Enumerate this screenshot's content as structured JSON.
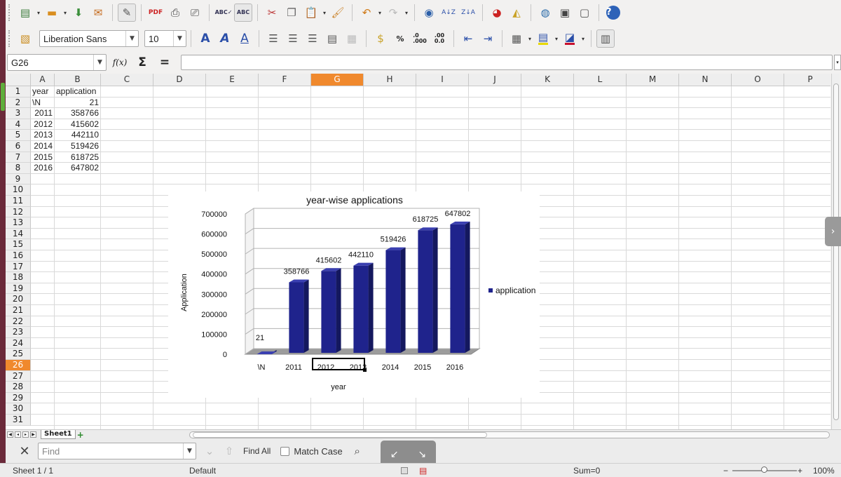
{
  "toolbar_standard": {
    "icons": [
      "new-icon",
      "open-icon",
      "save-icon",
      "export-icon",
      "edit-file-icon",
      "export-pdf-icon",
      "print-icon",
      "print-preview-icon",
      "spellcheck-icon",
      "autospellcheck-icon",
      "cut-icon",
      "copy-icon",
      "paste-icon",
      "clone-format-icon",
      "undo-icon",
      "redo-icon",
      "navigator-icon",
      "sort-ascending-icon",
      "sort-descending-icon",
      "insert-chart-icon",
      "draw-functions-icon",
      "gallery-icon",
      "data-sources-icon",
      "help-icon"
    ]
  },
  "toolbar_format": {
    "font_name": "Liberation Sans",
    "font_size": "10",
    "number_buttons": {
      "percent": "%",
      "add_decimal": ".0\n.000",
      "del_decimal": ".00\n0.0"
    }
  },
  "formula_bar": {
    "name_box": "G26",
    "function_wizard": "f(x)",
    "sum": "Σ",
    "equals": "=",
    "content": ""
  },
  "grid": {
    "columns": [
      "A",
      "B",
      "C",
      "D",
      "E",
      "F",
      "G",
      "H",
      "I",
      "J",
      "K",
      "L",
      "M",
      "N",
      "O",
      "P"
    ],
    "selected_column": "G",
    "rows": [
      "1",
      "2",
      "3",
      "4",
      "5",
      "6",
      "7",
      "8",
      "9",
      "10",
      "11",
      "12",
      "13",
      "14",
      "15",
      "16",
      "17",
      "18",
      "19",
      "20",
      "21",
      "22",
      "23",
      "24",
      "25",
      "26",
      "27",
      "28",
      "29",
      "30",
      "31"
    ],
    "selected_row": "26",
    "cells": {
      "A1": "year",
      "B1": "application",
      "A2": "\\N",
      "B2": "21",
      "A3": "2011",
      "B3": "358766",
      "A4": "2012",
      "B4": "415602",
      "A5": "2013",
      "B5": "442110",
      "A6": "2014",
      "B6": "519426",
      "A7": "2015",
      "B7": "618725",
      "A8": "2016",
      "B8": "647802"
    }
  },
  "chart_data": {
    "type": "bar",
    "title": "year-wise applications",
    "xlabel": "year",
    "ylabel": "Application",
    "categories": [
      "\\N",
      "2011",
      "2012",
      "2013",
      "2014",
      "2015",
      "2016"
    ],
    "series": [
      {
        "name": "application",
        "values": [
          21,
          358766,
          415602,
          442110,
          519426,
          618725,
          647802
        ],
        "color": "#1f238c"
      }
    ],
    "ylim": [
      0,
      700000
    ],
    "yticks": [
      0,
      100000,
      200000,
      300000,
      400000,
      500000,
      600000,
      700000
    ],
    "data_labels": [
      "21",
      "358766",
      "415602",
      "442110",
      "519426",
      "618725",
      "647802"
    ],
    "legend": "right",
    "style": "3d-bars",
    "grid": true
  },
  "sheet_tabs": {
    "active": "Sheet1"
  },
  "find_bar": {
    "placeholder": "Find",
    "find_all": "Find All",
    "match_case": "Match Case"
  },
  "status_bar": {
    "sheet": "Sheet 1 / 1",
    "page_style": "Default",
    "sum": "Sum=0",
    "zoom": "100%"
  }
}
